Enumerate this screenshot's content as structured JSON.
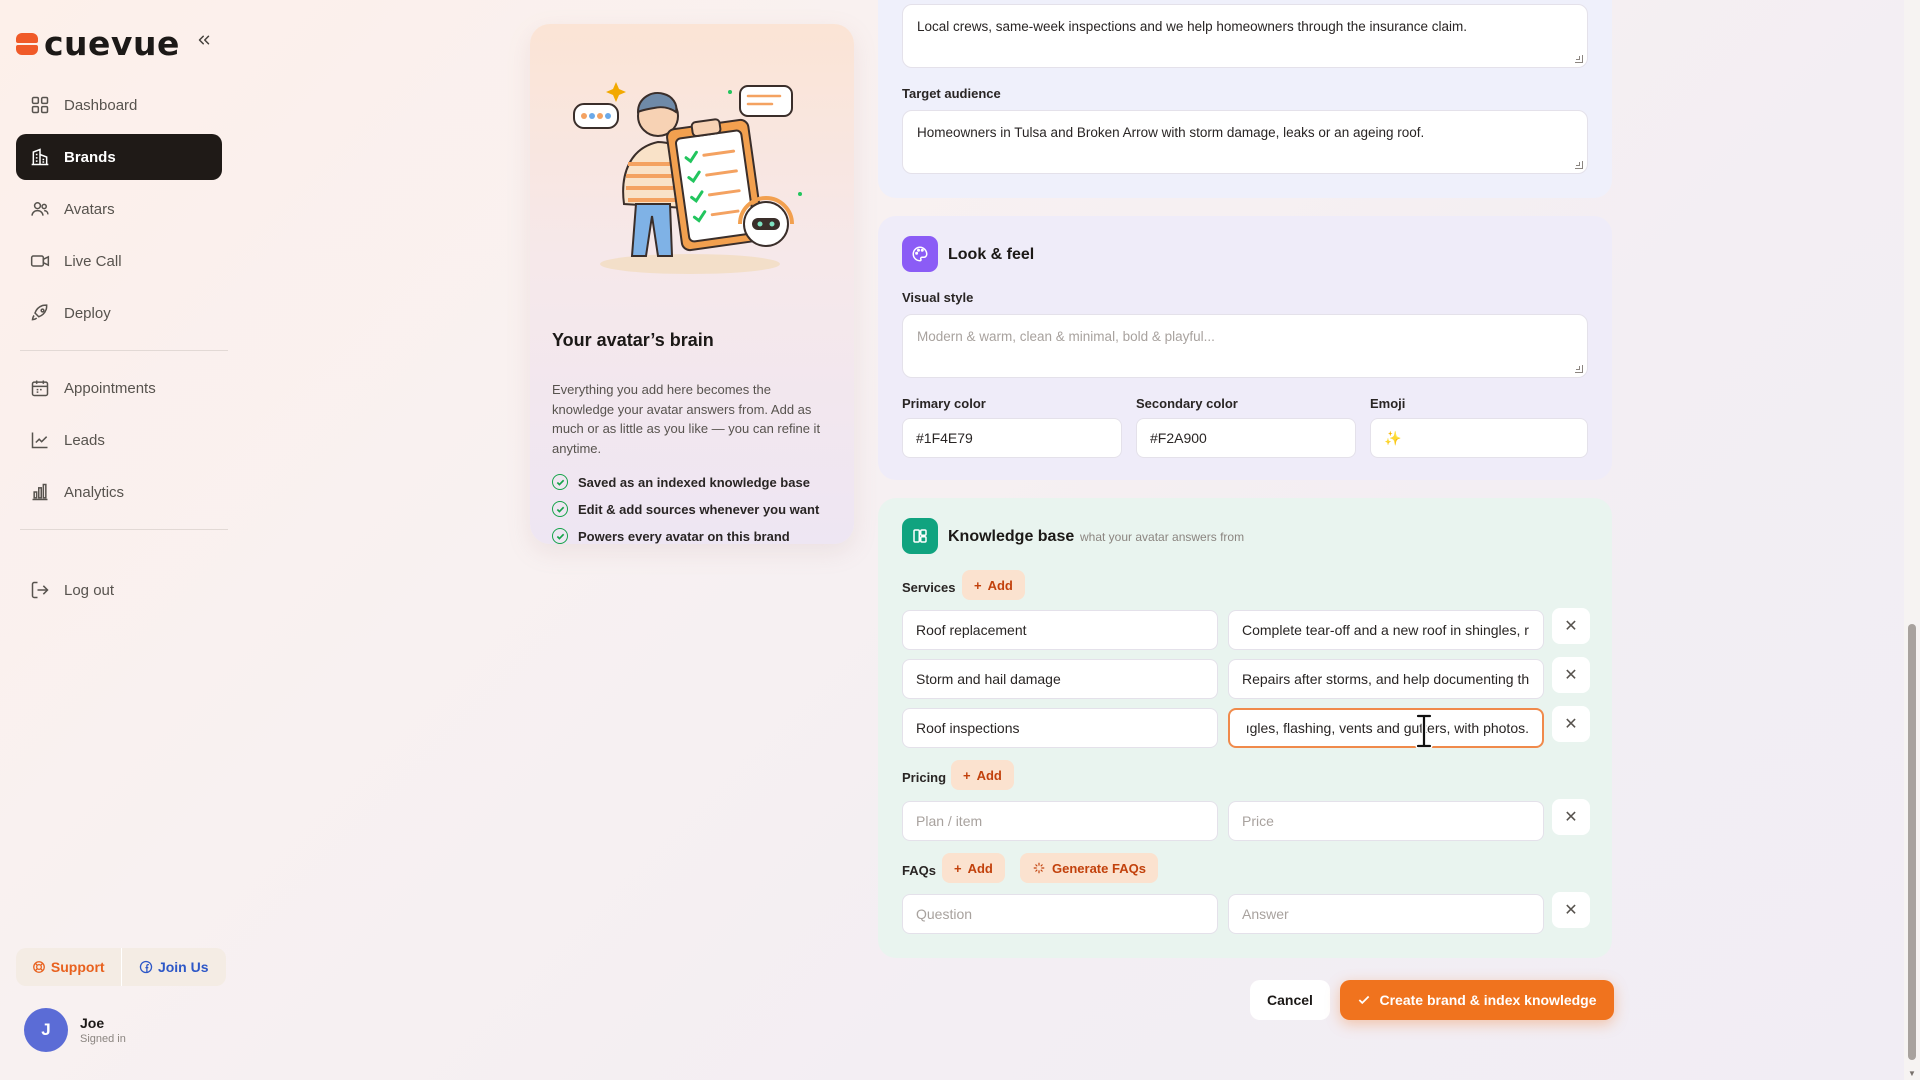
{
  "app": {
    "logo_text": "cuevue"
  },
  "sidebar": {
    "items": [
      {
        "label": "Dashboard",
        "icon": "dashboard-icon"
      },
      {
        "label": "Brands",
        "icon": "brands-icon",
        "active": true
      },
      {
        "label": "Avatars",
        "icon": "avatars-icon"
      },
      {
        "label": "Live Call",
        "icon": "video-icon"
      },
      {
        "label": "Deploy",
        "icon": "rocket-icon"
      },
      {
        "label": "Appointments",
        "icon": "calendar-icon"
      },
      {
        "label": "Leads",
        "icon": "trend-icon"
      },
      {
        "label": "Analytics",
        "icon": "bar-chart-icon"
      },
      {
        "label": "Log out",
        "icon": "logout-icon"
      }
    ],
    "support_label": "Support",
    "join_label": "Join Us",
    "user": {
      "initial": "J",
      "name": "Joe",
      "status": "Signed in"
    }
  },
  "brain": {
    "title": "Your avatar’s brain",
    "description": "Everything you add here becomes the knowledge your avatar answers from. Add as much or as little as you like — you can refine it anytime.",
    "points": [
      "Saved as an indexed knowledge base",
      "Edit & add sources whenever you want",
      "Powers every avatar on this brand"
    ]
  },
  "form": {
    "pitch_value": "Local crews, same-week inspections and we help homeowners through the insurance claim.",
    "target_audience_label": "Target audience",
    "target_audience_value": "Homeowners in Tulsa and Broken Arrow with storm damage, leaks or an ageing roof.",
    "look": {
      "title": "Look & feel",
      "visual_style_label": "Visual style",
      "visual_style_placeholder": "Modern & warm, clean & minimal, bold & playful...",
      "primary_label": "Primary color",
      "primary_value": "#1F4E79",
      "secondary_label": "Secondary color",
      "secondary_value": "#F2A900",
      "emoji_label": "Emoji",
      "emoji_value": "✨"
    },
    "kb": {
      "title": "Knowledge base",
      "subtitle": "what your avatar answers from",
      "services_label": "Services",
      "add_label": "Add",
      "services": [
        {
          "name": "Roof replacement",
          "desc": "Complete tear-off and a new roof in shingles, r"
        },
        {
          "name": "Storm and hail damage",
          "desc": "Repairs after storms, and help documenting th"
        },
        {
          "name": "Roof inspections",
          "desc": "ıgles, flashing, vents and gutters, with photos."
        }
      ],
      "pricing_label": "Pricing",
      "plan_placeholder": "Plan / item",
      "price_placeholder": "Price",
      "faqs_label": "FAQs",
      "generate_label": "Generate FAQs",
      "question_placeholder": "Question",
      "answer_placeholder": "Answer"
    }
  },
  "actions": {
    "cancel": "Cancel",
    "create": "Create brand & index knowledge"
  },
  "colors": {
    "accent": "#F0731E",
    "active_nav": "#1F1A17",
    "success": "#16A34A"
  }
}
